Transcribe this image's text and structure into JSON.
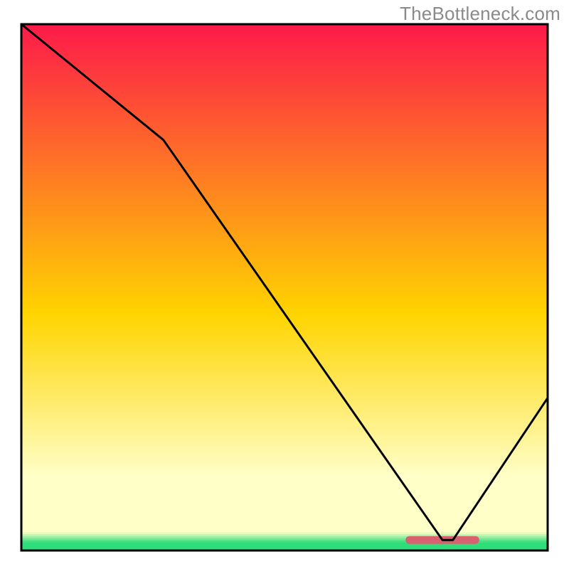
{
  "watermark": {
    "text": "TheBottleneck.com"
  },
  "chart_data": {
    "type": "line",
    "title": "",
    "xlabel": "",
    "ylabel": "",
    "xlim": [
      0,
      100
    ],
    "ylim": [
      0,
      100
    ],
    "x": [
      0,
      27,
      80,
      82,
      100
    ],
    "values": [
      100,
      78,
      2,
      2,
      29
    ],
    "legend": null,
    "grid": false,
    "background_gradient": {
      "top": "#fd1a4a",
      "mid": "#ffd400",
      "pale": "#ffffc8",
      "bottom": "#2fdd7a"
    },
    "marker_segment": {
      "x_start": 73,
      "x_end": 87,
      "y": 2,
      "color": "#d7616e"
    }
  }
}
